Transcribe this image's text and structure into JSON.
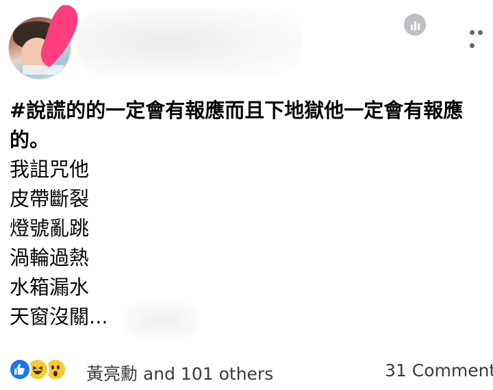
{
  "header": {
    "avatar_icon": "profile-photo",
    "insights_icon": "bar-chart-icon",
    "more_icon": "more-horizontal-icon"
  },
  "post": {
    "headline": "#說謊的的一定會有報應而且下地獄他一定會有報應的。",
    "lines": [
      "我詛咒他",
      "皮帶斷裂",
      "燈號亂跳",
      "渦輪過熱",
      "水箱漏水",
      "天窗沒關..."
    ]
  },
  "footer": {
    "reactions": [
      "like",
      "haha",
      "wow"
    ],
    "reactors_text": "黃亮勳 and 101 others",
    "comments_text": "31 Comment"
  },
  "colors": {
    "like": "#1877f2",
    "emoji": "#f7c934",
    "redaction_pink": "#ff3d7f",
    "text": "#050505",
    "meta_text": "#3a3b3c"
  }
}
